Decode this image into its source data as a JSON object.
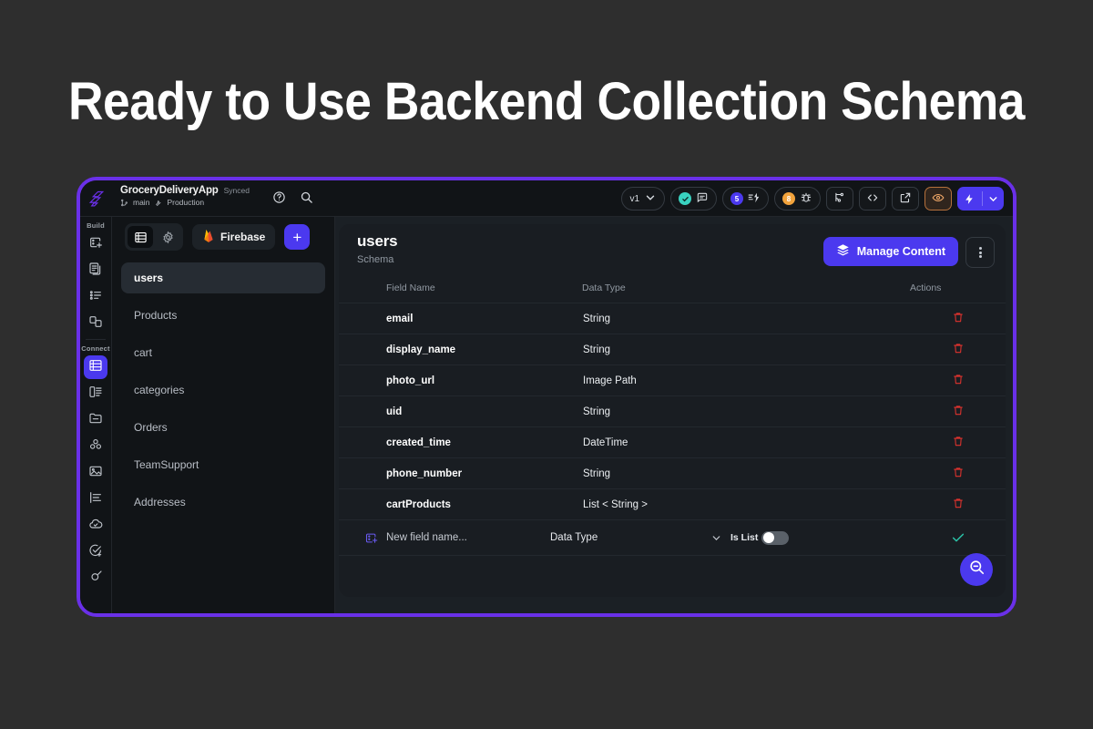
{
  "headline": "Ready to Use Backend Collection Schema",
  "window": {
    "topbar": {
      "app_name": "GroceryDeliveryApp",
      "sync_status": "Synced",
      "branch": "main",
      "environment": "Production",
      "help_icon": "help-circle-icon",
      "search_icon": "search-icon",
      "version_label": "v1",
      "chat_badge": "",
      "test_badge": "5",
      "bug_badge": "8",
      "icons": {
        "branch": "git-branch-icon",
        "code": "code-icon",
        "open": "external-link-icon",
        "preview": "eye-icon",
        "run": "lightning-bolt-icon",
        "run_chevron": "chevron-down-icon"
      }
    },
    "rail": {
      "logo": "flutterflow-logo-icon",
      "groups": [
        {
          "label": "Build",
          "items": [
            {
              "icon": "add-page-icon",
              "active": false
            },
            {
              "icon": "pages-icon",
              "active": false
            },
            {
              "icon": "list-icon",
              "active": false
            },
            {
              "icon": "components-icon",
              "active": false
            }
          ]
        },
        {
          "label": "Connect",
          "items": [
            {
              "icon": "database-icon",
              "active": true
            },
            {
              "icon": "app-state-icon",
              "active": false
            },
            {
              "icon": "storage-folder-icon",
              "active": false
            },
            {
              "icon": "users-auth-icon",
              "active": false
            },
            {
              "icon": "media-assets-icon",
              "active": false
            },
            {
              "icon": "localization-icon",
              "active": false
            },
            {
              "icon": "cloud-functions-icon",
              "active": false
            },
            {
              "icon": "tests-icon",
              "active": false
            },
            {
              "icon": "integrations-icon",
              "active": false
            }
          ]
        }
      ]
    },
    "collections_panel": {
      "view_toggle": [
        {
          "icon": "database-icon",
          "active": true
        },
        {
          "icon": "gear-icon",
          "active": false
        }
      ],
      "backend_chip": {
        "icon": "firebase-flame-icon",
        "label": "Firebase"
      },
      "add_button": "+",
      "items": [
        {
          "label": "users",
          "active": true
        },
        {
          "label": "Products",
          "active": false
        },
        {
          "label": "cart",
          "active": false
        },
        {
          "label": "categories",
          "active": false
        },
        {
          "label": "Orders",
          "active": false
        },
        {
          "label": "TeamSupport",
          "active": false
        },
        {
          "label": "Addresses",
          "active": false
        }
      ]
    },
    "content": {
      "title": "users",
      "subtitle": "Schema",
      "manage_button": {
        "label": "Manage Content",
        "icon": "layers-icon"
      },
      "kebab": "more-options-icon",
      "columns": [
        "Field Name",
        "Data Type",
        "Actions"
      ],
      "rows": [
        {
          "field": "email",
          "type": "String",
          "action_icon": "trash-icon"
        },
        {
          "field": "display_name",
          "type": "String",
          "action_icon": "trash-icon"
        },
        {
          "field": "photo_url",
          "type": "Image Path",
          "action_icon": "trash-icon"
        },
        {
          "field": "uid",
          "type": "String",
          "action_icon": "trash-icon"
        },
        {
          "field": "created_time",
          "type": "DateTime",
          "action_icon": "trash-icon"
        },
        {
          "field": "phone_number",
          "type": "String",
          "action_icon": "trash-icon"
        },
        {
          "field": "cartProducts",
          "type": "List < String >",
          "action_icon": "trash-icon"
        }
      ],
      "new_field_row": {
        "icon": "add-field-icon",
        "placeholder": "New field name...",
        "data_type_label": "Data Type",
        "chevron": "chevron-down-icon",
        "is_list_label": "Is List",
        "is_list_value": "off",
        "confirm_icon": "check-icon"
      },
      "fab": "zoom-out-icon"
    }
  },
  "colors": {
    "page_bg": "#2e2e2e",
    "window_border": "#6a30e8",
    "accent_purple": "#4b39ef",
    "teal": "#39d2c0",
    "orange": "#f2a33c",
    "delete_red": "#e0332e",
    "confirm_green": "#2bc3a8"
  }
}
